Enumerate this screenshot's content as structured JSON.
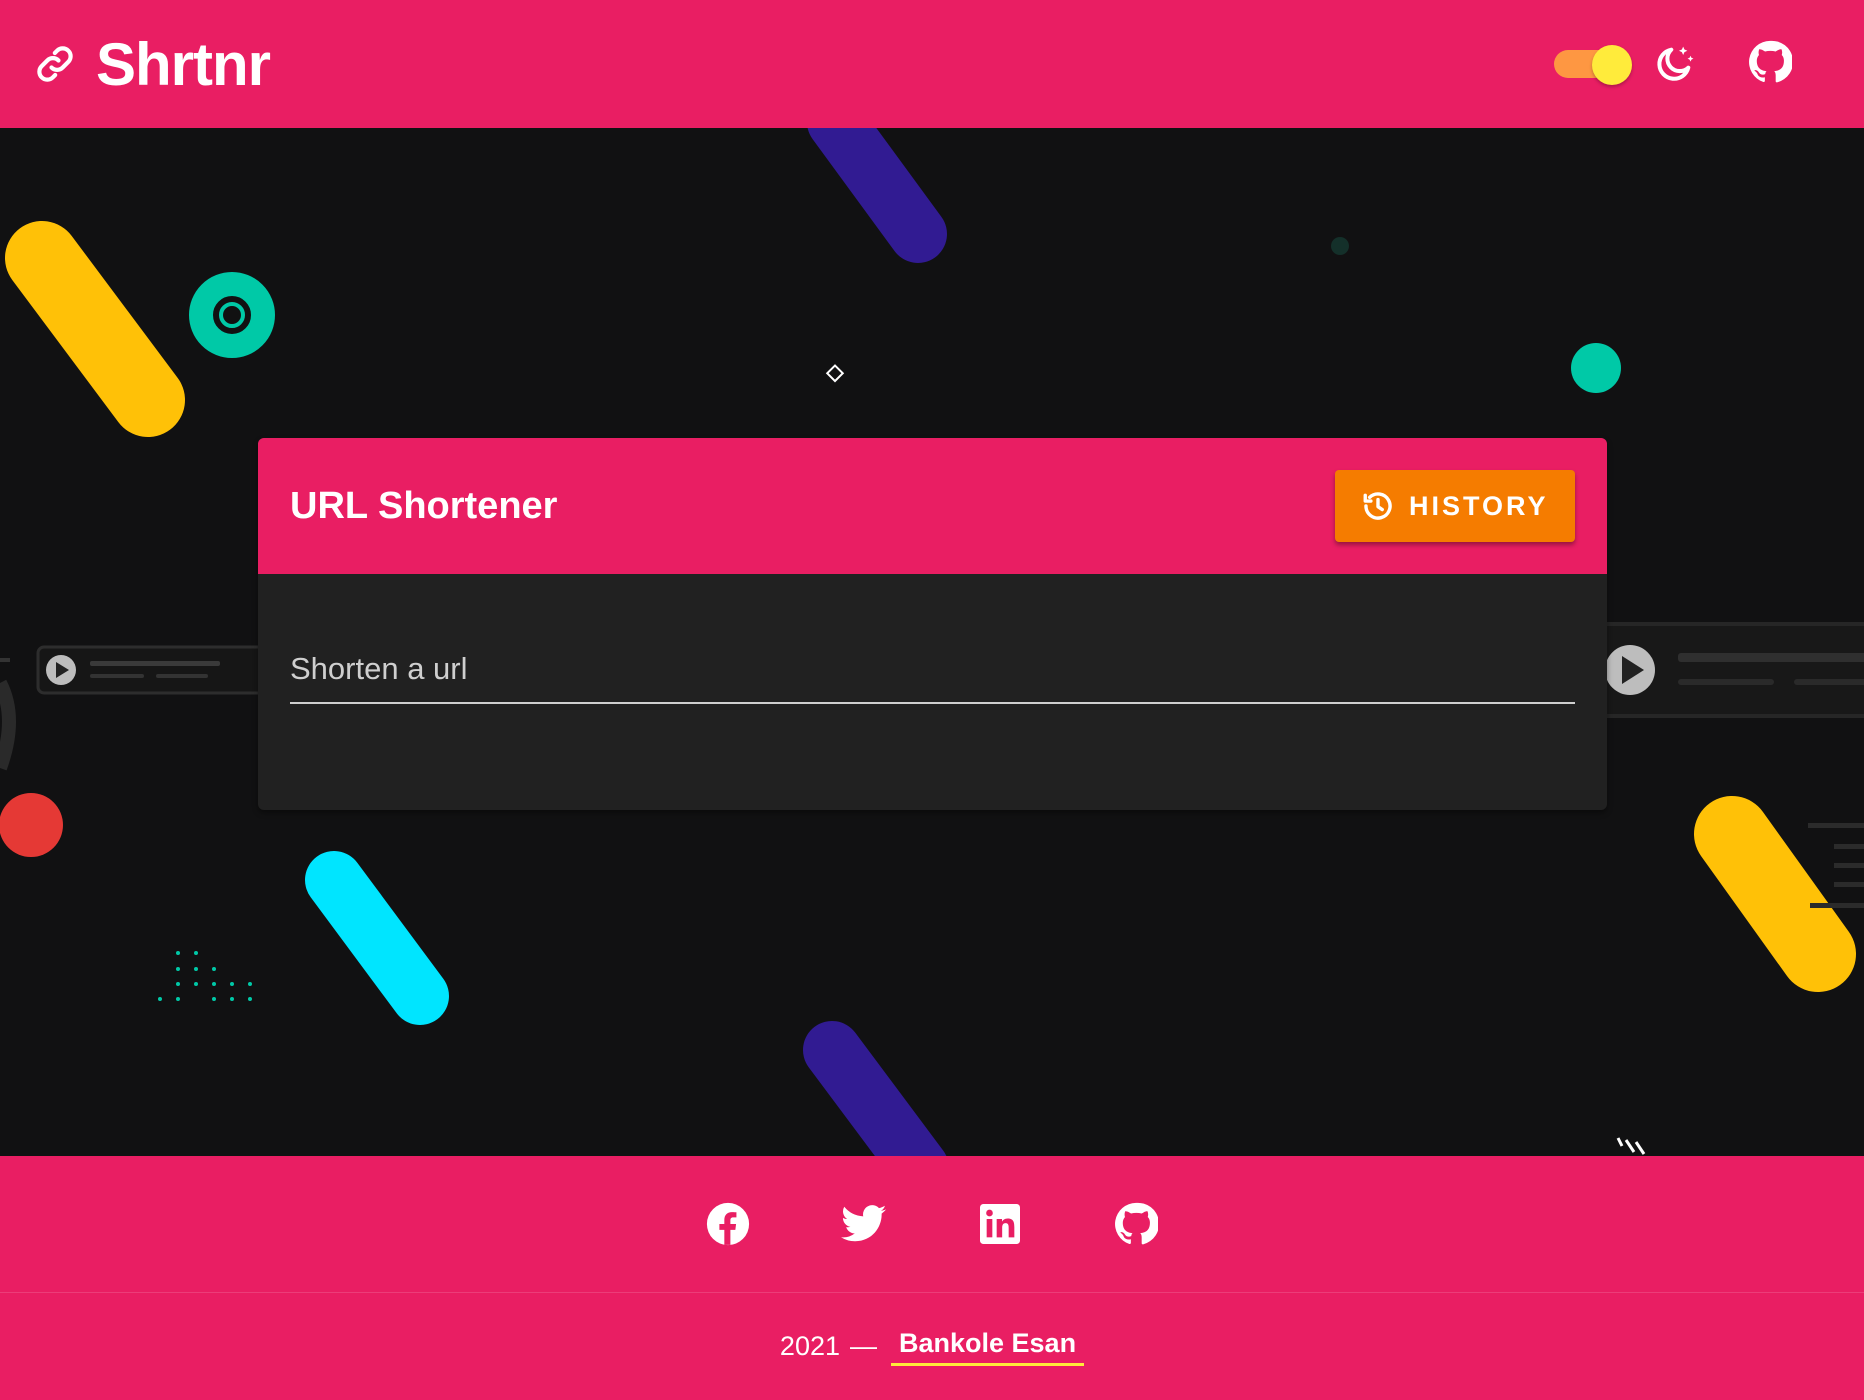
{
  "header": {
    "brand_title": "Shrtnr",
    "theme_toggle_on": true
  },
  "card": {
    "title": "URL Shortener",
    "history_label": "HISTORY",
    "input_placeholder": "Shorten a url",
    "input_value": ""
  },
  "footer": {
    "social_links": [
      "facebook-icon",
      "twitter-icon",
      "linkedin-icon",
      "github-icon"
    ],
    "year": "2021",
    "dash": "—",
    "author": "Bankole Esan"
  },
  "colors": {
    "primary": "#e91e63",
    "accent_button": "#f57c00",
    "background": "#111112",
    "card_background": "#212121",
    "toggle_thumb": "#ffeb3b",
    "toggle_track": "#ff9e40",
    "author_underline": "#ffeb3b"
  }
}
